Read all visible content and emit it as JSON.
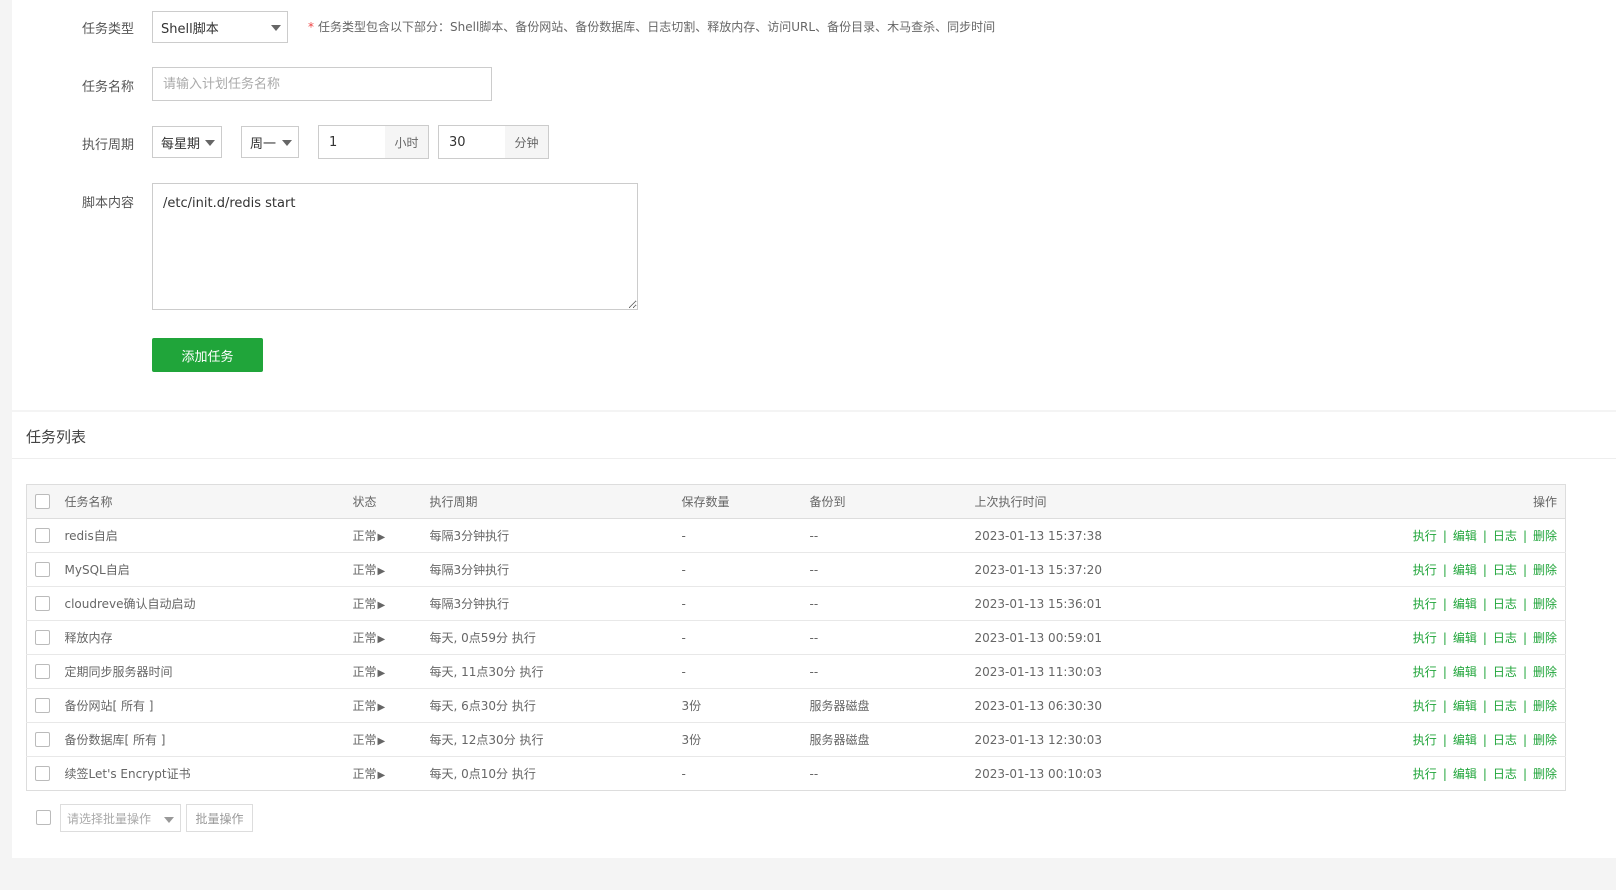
{
  "form": {
    "task_type": {
      "label": "任务类型",
      "value": "Shell脚本",
      "hint_star": "*",
      "hint": "任务类型包含以下部分：Shell脚本、备份网站、备份数据库、日志切割、释放内存、访问URL、备份目录、木马查杀、同步时间"
    },
    "task_name": {
      "label": "任务名称",
      "value": "",
      "placeholder": "请输入计划任务名称"
    },
    "cycle": {
      "label": "执行周期",
      "period": "每星期",
      "weekday": "周一",
      "hour": "1",
      "hour_unit": "小时",
      "minute": "30",
      "minute_unit": "分钟"
    },
    "script": {
      "label": "脚本内容",
      "value": "/etc/init.d/redis start"
    },
    "add_button": "添加任务"
  },
  "list": {
    "title": "任务列表",
    "columns": [
      "任务名称",
      "状态",
      "执行周期",
      "保存数量",
      "备份到",
      "上次执行时间",
      "操作"
    ],
    "rows": [
      {
        "name": "redis自启",
        "status": "正常",
        "cycle": "每隔3分钟执行",
        "keep": "-",
        "backup_to": "--",
        "last_run": "2023-01-13 15:37:38"
      },
      {
        "name": "MySQL自启",
        "status": "正常",
        "cycle": "每隔3分钟执行",
        "keep": "-",
        "backup_to": "--",
        "last_run": "2023-01-13 15:37:20"
      },
      {
        "name": "cloudreve确认自动启动",
        "status": "正常",
        "cycle": "每隔3分钟执行",
        "keep": "-",
        "backup_to": "--",
        "last_run": "2023-01-13 15:36:01"
      },
      {
        "name": "释放内存",
        "status": "正常",
        "cycle": "每天, 0点59分 执行",
        "keep": "-",
        "backup_to": "--",
        "last_run": "2023-01-13 00:59:01"
      },
      {
        "name": "定期同步服务器时间",
        "status": "正常",
        "cycle": "每天, 11点30分 执行",
        "keep": "-",
        "backup_to": "--",
        "last_run": "2023-01-13 11:30:03"
      },
      {
        "name": "备份网站[ 所有 ]",
        "status": "正常",
        "cycle": "每天, 6点30分 执行",
        "keep": "3份",
        "backup_to": "服务器磁盘",
        "last_run": "2023-01-13 06:30:30"
      },
      {
        "name": "备份数据库[ 所有 ]",
        "status": "正常",
        "cycle": "每天, 12点30分 执行",
        "keep": "3份",
        "backup_to": "服务器磁盘",
        "last_run": "2023-01-13 12:30:03"
      },
      {
        "name": "续签Let's Encrypt证书",
        "status": "正常",
        "cycle": "每天, 0点10分 执行",
        "keep": "-",
        "backup_to": "--",
        "last_run": "2023-01-13 00:10:03"
      }
    ],
    "ops": {
      "run": "执行",
      "edit": "编辑",
      "log": "日志",
      "delete": "删除",
      "separator": "|"
    },
    "status_icon": "play-triangle-icon",
    "batch": {
      "placeholder": "请选择批量操作",
      "button": "批量操作"
    }
  },
  "colors": {
    "accent": "#20a53a",
    "required": "#ee4444"
  }
}
